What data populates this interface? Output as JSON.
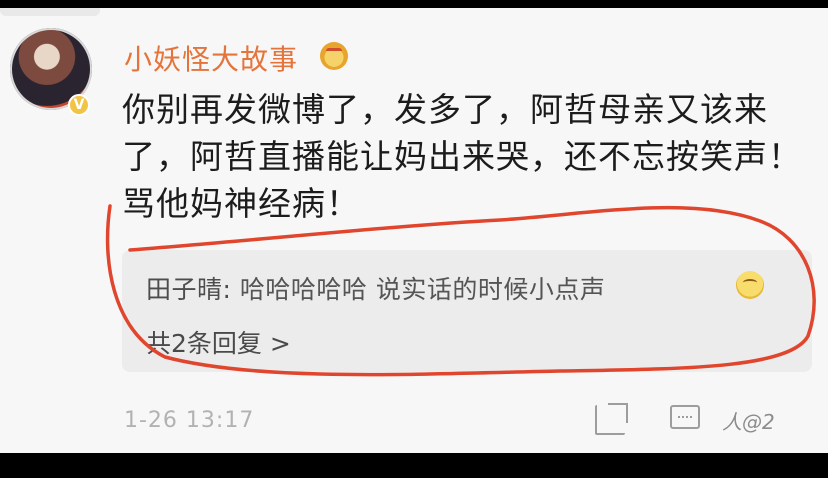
{
  "post": {
    "username": "小妖怪大故事",
    "username_color": "#e5743b",
    "text_line1": "你别再发微博了，发多了，阿哲母亲又该来",
    "text_line2": "了，阿哲直播能让妈出来哭，还不忘按笑声！",
    "text_line3": "骂他妈神经病！",
    "timestamp": "1-26 13:17",
    "watermark": "人@2"
  },
  "reply": {
    "author": "田子晴:",
    "text": "哈哈哈哈哈 说实话的时候小点声",
    "count_label": "共2条回复 >"
  },
  "icons": {
    "avatar": "avatar-image",
    "badge": "verified-badge-icon",
    "medal": "medal-icon",
    "laugh": "laugh-emoji-icon",
    "share": "share-icon",
    "comment": "comment-icon"
  },
  "annotation_color": "#e0462d"
}
